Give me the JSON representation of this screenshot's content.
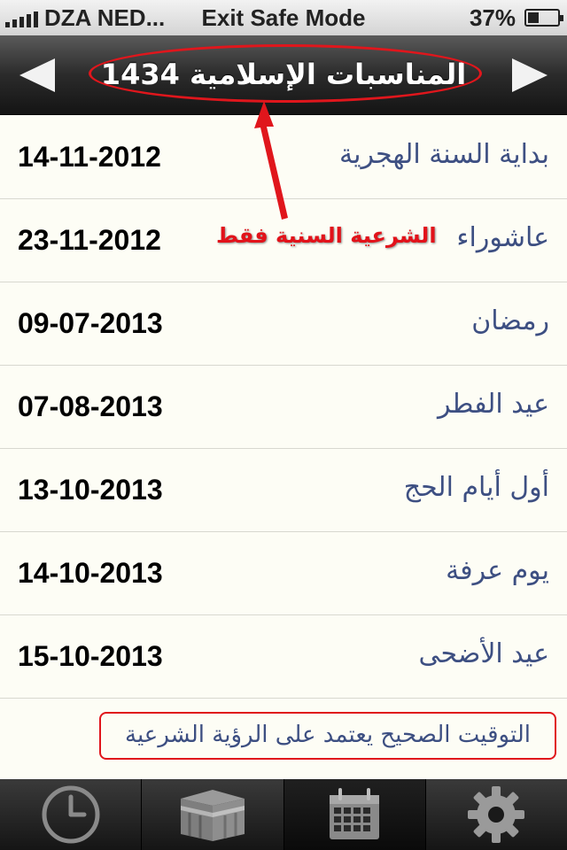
{
  "status_bar": {
    "carrier": "DZA NED...",
    "center_text": "Exit Safe Mode",
    "battery_percent": "37%",
    "battery_level": 0.37
  },
  "nav": {
    "title": "المناسبات الإسلامية 1434",
    "prev_icon": "left-triangle-icon",
    "next_icon": "right-triangle-icon"
  },
  "events": [
    {
      "date": "14-11-2012",
      "name": "بداية السنة الهجرية"
    },
    {
      "date": "23-11-2012",
      "name": "عاشوراء"
    },
    {
      "date": "09-07-2013",
      "name": "رمضان"
    },
    {
      "date": "07-08-2013",
      "name": "عيد الفطر"
    },
    {
      "date": "13-10-2013",
      "name": "أول أيام الحج"
    },
    {
      "date": "14-10-2013",
      "name": "يوم عرفة"
    },
    {
      "date": "15-10-2013",
      "name": "عيد الأضحى"
    }
  ],
  "annotation": {
    "text": "الشرعية السنية فقط"
  },
  "footer_note": "التوقيت الصحيح يعتمد على الرؤية الشرعية",
  "tabs": [
    {
      "icon": "clock-icon",
      "selected": false
    },
    {
      "icon": "kaaba-icon",
      "selected": false
    },
    {
      "icon": "calendar-icon",
      "selected": true
    },
    {
      "icon": "gear-icon",
      "selected": false
    }
  ],
  "colors": {
    "accent_red": "#e0161c",
    "event_text": "#3d4f82",
    "list_background": "#fdfdf5"
  }
}
